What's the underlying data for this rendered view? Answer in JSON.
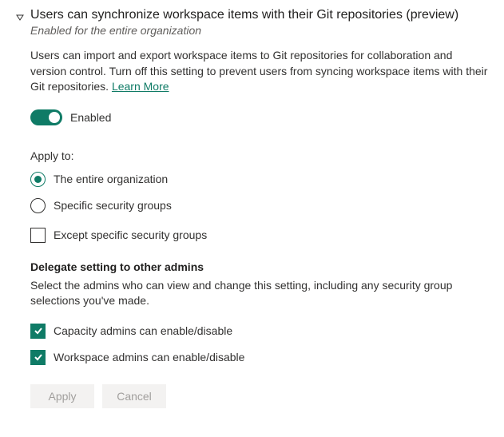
{
  "title": "Users can synchronize workspace items with their Git repositories (preview)",
  "subtitle": "Enabled for the entire organization",
  "description": "Users can import and export workspace items to Git repositories for collaboration and version control. Turn off this setting to prevent users from syncing workspace items with their Git repositories. ",
  "learn_more": "Learn More",
  "toggle": {
    "state_label": "Enabled"
  },
  "apply_to": {
    "label": "Apply to:",
    "options": {
      "entire_org": "The entire organization",
      "security_groups": "Specific security groups"
    },
    "except_label": "Except specific security groups"
  },
  "delegate": {
    "header": "Delegate setting to other admins",
    "description": "Select the admins who can view and change this setting, including any security group selections you've made.",
    "capacity_label": "Capacity admins can enable/disable",
    "workspace_label": "Workspace admins can enable/disable"
  },
  "buttons": {
    "apply": "Apply",
    "cancel": "Cancel"
  }
}
